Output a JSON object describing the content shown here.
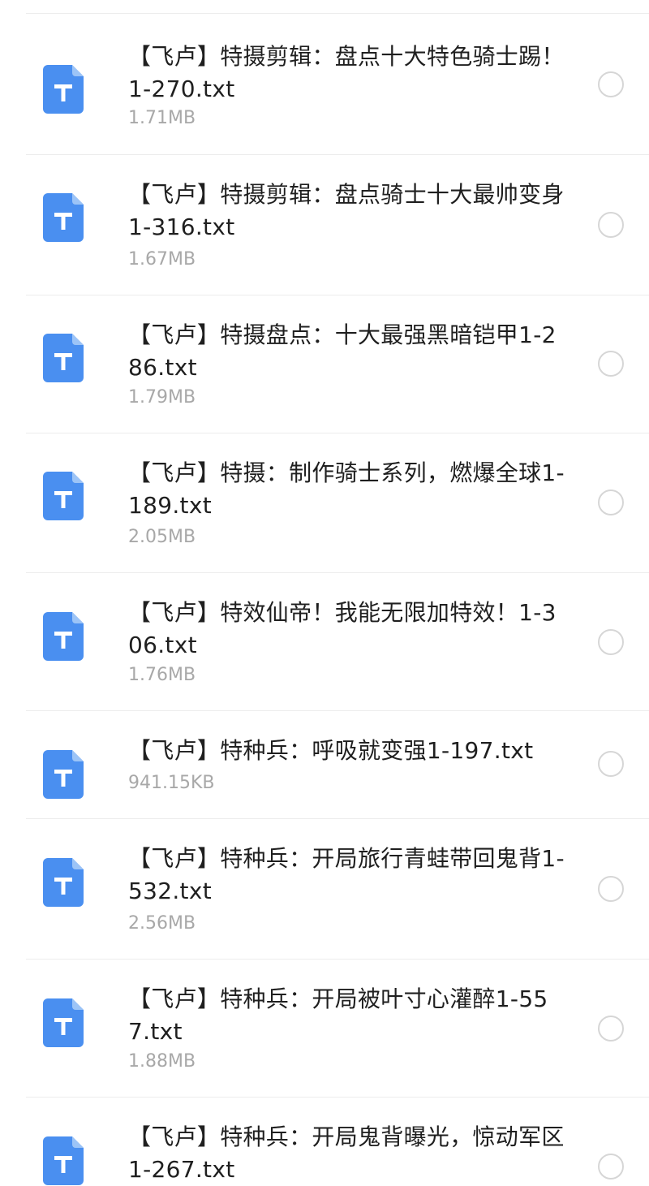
{
  "colors": {
    "icon_blue": "#4a8ff0",
    "icon_fold": "#9cc4f7",
    "name_text": "#1f1f1f",
    "size_text": "#a8a8a8",
    "radio_border": "#d6d6d6",
    "divider": "#ececec"
  },
  "icon": {
    "type": "txt-file-icon",
    "glyph": "T"
  },
  "files": [
    {
      "name": "【飞卢】特摄剪辑：盘点十大特色骑士踢！1-270.txt",
      "size": "1.71MB",
      "selected": false
    },
    {
      "name": "【飞卢】特摄剪辑：盘点骑士十大最帅变身1-316.txt",
      "size": "1.67MB",
      "selected": false
    },
    {
      "name": "【飞卢】特摄盘点：十大最强黑暗铠甲1-286.txt",
      "size": "1.79MB",
      "selected": false
    },
    {
      "name": "【飞卢】特摄：制作骑士系列，燃爆全球1-189.txt",
      "size": "2.05MB",
      "selected": false
    },
    {
      "name": "【飞卢】特效仙帝！我能无限加特效！1-306.txt",
      "size": "1.76MB",
      "selected": false
    },
    {
      "name": "【飞卢】特种兵：呼吸就变强1-197.txt",
      "size": "941.15KB",
      "selected": false
    },
    {
      "name": "【飞卢】特种兵：开局旅行青蛙带回鬼背1-532.txt",
      "size": "2.56MB",
      "selected": false
    },
    {
      "name": "【飞卢】特种兵：开局被叶寸心灌醉1-557.txt",
      "size": "1.88MB",
      "selected": false
    },
    {
      "name": "【飞卢】特种兵：开局鬼背曝光，惊动军区1-267.txt",
      "size": "",
      "selected": false
    }
  ]
}
